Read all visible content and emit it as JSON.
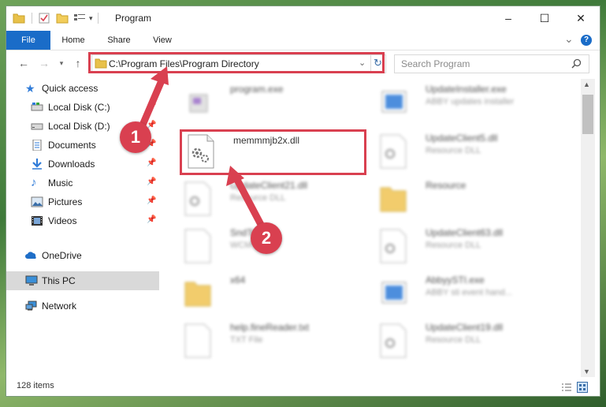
{
  "window": {
    "title": "Program",
    "controls": {
      "minimize": "–",
      "maximize": "☐",
      "close": "✕"
    }
  },
  "ribbon": {
    "tabs": [
      "File",
      "Home",
      "Share",
      "View"
    ],
    "help": "?",
    "expand": "⌄"
  },
  "navigation": {
    "address": "C:\\Program Files\\Program Directory",
    "search_placeholder": "Search Program"
  },
  "sidebar": {
    "items": [
      {
        "label": "Quick access",
        "icon": "star-icon",
        "pinned": false
      },
      {
        "label": "Local Disk (C:)",
        "icon": "drive-icon",
        "pinned": true
      },
      {
        "label": "Local Disk (D:)",
        "icon": "drive-icon",
        "pinned": true
      },
      {
        "label": "Documents",
        "icon": "documents-icon",
        "pinned": true
      },
      {
        "label": "Downloads",
        "icon": "download-icon",
        "pinned": true
      },
      {
        "label": "Music",
        "icon": "music-icon",
        "pinned": true
      },
      {
        "label": "Pictures",
        "icon": "pictures-icon",
        "pinned": true
      },
      {
        "label": "Videos",
        "icon": "videos-icon",
        "pinned": true
      },
      {
        "label": "OneDrive",
        "icon": "cloud-icon",
        "pinned": false
      },
      {
        "label": "This PC",
        "icon": "computer-icon",
        "pinned": false,
        "selected": true
      },
      {
        "label": "Network",
        "icon": "network-icon",
        "pinned": false
      }
    ]
  },
  "files": [
    {
      "name": "program.exe",
      "desc": "",
      "type": "exe",
      "blurred": true
    },
    {
      "name": "UpdateInstaller.exe",
      "desc": "ABBY updates installer",
      "type": "app",
      "blurred": true
    },
    {
      "name": "memmmjb2x.dll",
      "desc": "",
      "type": "dll",
      "blurred": false,
      "highlighted": true
    },
    {
      "name": "UpdateClient5.dll",
      "desc": "Resource DLL",
      "type": "dll",
      "blurred": true
    },
    {
      "name": "UpdateClient21.dll",
      "desc": "Resource DLL",
      "type": "dll",
      "blurred": true
    },
    {
      "name": "Resource",
      "desc": "",
      "type": "folder",
      "blurred": true
    },
    {
      "name": "SndTo...cm",
      "desc": "WCM F...",
      "type": "file",
      "blurred": true
    },
    {
      "name": "UpdateClient63.dll",
      "desc": "Resource DLL",
      "type": "dll",
      "blurred": true
    },
    {
      "name": "x64",
      "desc": "",
      "type": "folder",
      "blurred": true
    },
    {
      "name": "AbbyySTI.exe",
      "desc": "ABBY sti event hand...",
      "type": "app",
      "blurred": true
    },
    {
      "name": "help.fineReader.txt",
      "desc": "TXT File",
      "type": "file",
      "blurred": true
    },
    {
      "name": "UpdateClient19.dll",
      "desc": "Resource DLL",
      "type": "dll",
      "blurred": true
    }
  ],
  "status": {
    "item_count": "128 items"
  },
  "callouts": [
    "1",
    "2"
  ],
  "colors": {
    "accent": "#1a6cc8",
    "highlight": "#d94050",
    "selected_bg": "#d9d9d9"
  }
}
